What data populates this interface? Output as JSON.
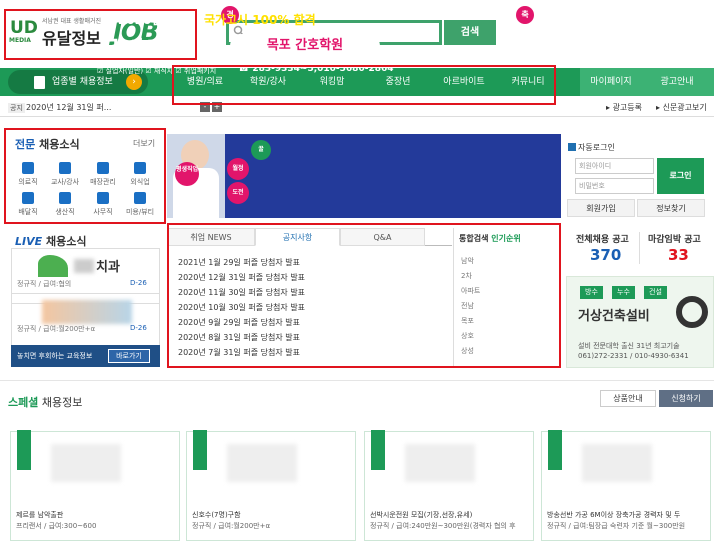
{
  "logo": {
    "ud": "UD",
    "media": "MEDIA",
    "tagline": "서남권 대표 생활매거진",
    "name": "유달정보",
    "job": "JOB"
  },
  "search": {
    "placeholder": "",
    "button": "검색"
  },
  "nav": {
    "by_category": "업종별 채용정보",
    "items": [
      "병원/의료",
      "학원/강사",
      "워킹맘",
      "중장년",
      "아르바이트",
      "커뮤니티"
    ],
    "mypage": "마이페이지",
    "ad_info": "광고안내"
  },
  "infobar": {
    "tag": "공지",
    "notice": "2020년 12월 31일 퍼...",
    "ad_register": "광고등록",
    "newspaper_ad": "신문광고보기"
  },
  "categories": {
    "title_highlight": "전문",
    "title_rest": "채용소식",
    "more": "더보기",
    "items": [
      "의료직",
      "교사/강사",
      "매장관리",
      "외식업",
      "배달직",
      "생산직",
      "사무직",
      "미용/뷰티"
    ]
  },
  "live": {
    "title_highlight": "LIVE",
    "title_rest": "채용소식",
    "cards": [
      {
        "name": "치과",
        "sub": "정규직 / 급여:협의",
        "dday": "D-26"
      },
      {
        "name": "",
        "sub": "정규직 / 급여:월200만+α",
        "dday": "D-26"
      }
    ],
    "edu_text": "놓치면 후회하는 교육정보",
    "edu_btn": "바로가기"
  },
  "banner": {
    "title_prefix": "2020년 하반기",
    "title_highlight": "국가고시 100% 합격",
    "big": "국비모집",
    "checks": "☑ 실업자(일반)  ☑ 재직자  ☑ 취업패키지",
    "school": "목포 간호학원",
    "small": "취업전담 상담사 관리",
    "phone": "☎ 283-9334~5,010-5680-2864",
    "badge_left": "경",
    "badge_right": "축",
    "bubbles": [
      "꿀",
      "평생직업",
      "월정",
      "도전"
    ]
  },
  "news_tabs": [
    "취업 NEWS",
    "공지사항",
    "Q&A"
  ],
  "news_items": [
    "2021년 1월 29일 퍼즐 당첨자 발표",
    "2020년 12월 31일 퍼즐 당첨자 발표",
    "2020년 11월 30일 퍼즐 당첨자 발표",
    "2020년 10월 30일 퍼즐 당첨자 발표",
    "2020년 9월 29일 퍼즐 당첨자 발표",
    "2020년 8월 31일 퍼즐 당첨자 발표",
    "2020년 7월 31일 퍼즐 당첨자 발표"
  ],
  "search_rank": {
    "title": "통합검색",
    "title_highlight": "인기순위",
    "items": [
      "남악",
      "2차",
      "아파트",
      "전남",
      "목포",
      "상호",
      "상성"
    ]
  },
  "login": {
    "auto_login": "자동로그인",
    "id_placeholder": "회원아이디",
    "pw_placeholder": "비밀번호",
    "button": "로그인",
    "signup": "회원가입",
    "find": "정보찾기"
  },
  "stats": {
    "total_label": "전체채용 공고",
    "total_value": "370",
    "deadline_label": "마감임박 공고",
    "deadline_value": "33"
  },
  "side_ad": {
    "chips": [
      "방수",
      "누수",
      "건설"
    ],
    "title": "거상건축설비",
    "desc": "설비 전문대학 출신 31년 최고기술",
    "phone": "061)272-2331 / 010-4930-6341"
  },
  "special": {
    "title_highlight": "스페셜",
    "title_rest": "채용정보",
    "product_btn": "상품안내",
    "apply_btn": "신청하기",
    "cards": [
      {
        "name": "제르를 남악출판",
        "sub": "프리랜서 / 급여:300~600"
      },
      {
        "name": "신호수(7명)구함",
        "sub": "정규직 / 급여:월200만+α"
      },
      {
        "name": "선박시운전원 모집(기장,선장,유세)",
        "sub": "정규직 / 급여:240만원~300만원(경력자 협의 후"
      },
      {
        "name": "방송선반 가공 6M이상 장축가공 경력자 및 두",
        "sub": "정규직 / 급여:팀장급 숙련자 기준 월~300만원"
      }
    ]
  },
  "colors": {
    "brand_green": "#1d9a57",
    "accent_blue": "#1a5fb4",
    "annotation_red": "#e0141e"
  }
}
